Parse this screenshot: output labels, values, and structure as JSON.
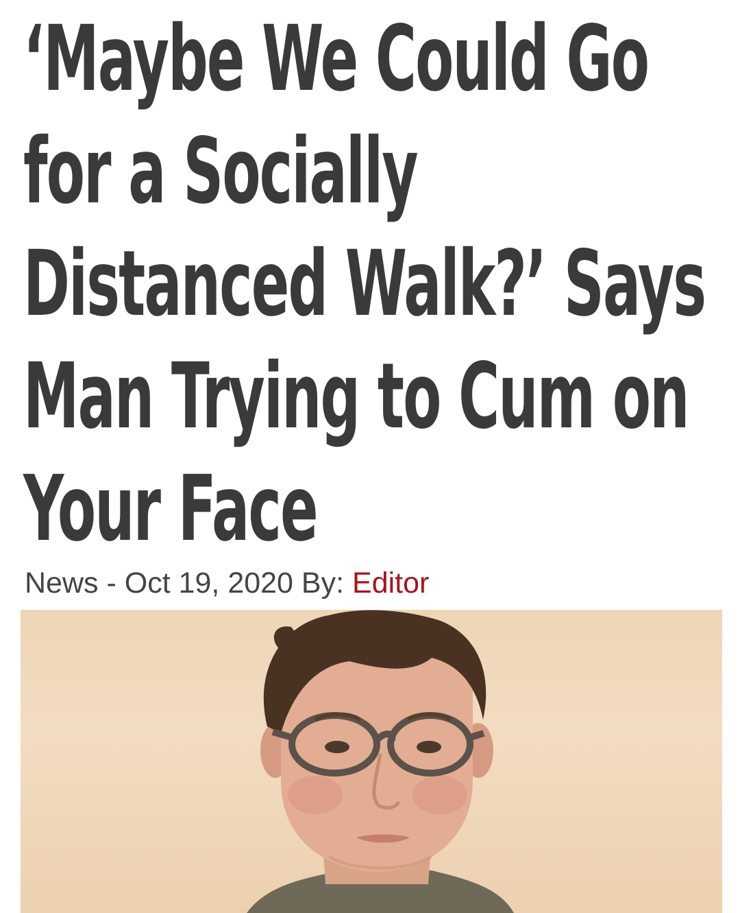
{
  "article": {
    "headline_lines": [
      "‘Maybe We Could Go",
      "for a Socially",
      "Distanced Walk?’ Says",
      "Man Trying to Cum on",
      "Your Face"
    ],
    "meta": {
      "category": "News",
      "separator": " - ",
      "date": "Oct 19, 2020",
      "by_label": " By: ",
      "author": "Editor"
    },
    "colors": {
      "headline": "#3a3a3a",
      "author_link": "#a8141c",
      "photo_background": "#efd5b6"
    }
  }
}
